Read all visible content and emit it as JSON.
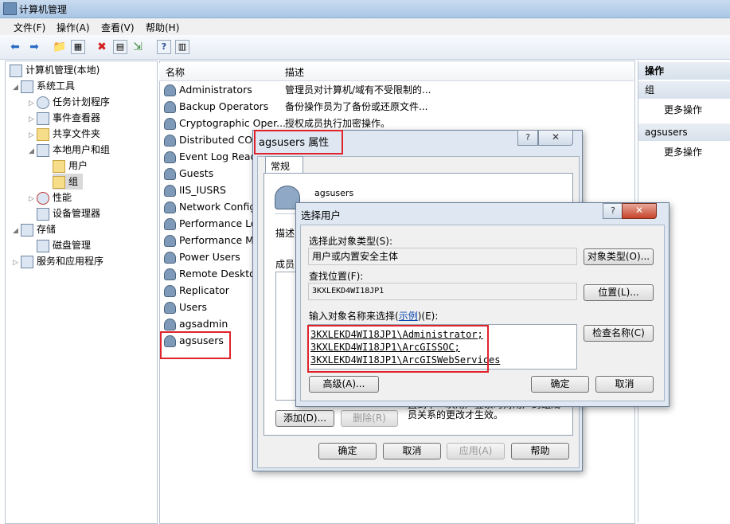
{
  "window": {
    "title": "计算机管理"
  },
  "menu": [
    "文件(F)",
    "操作(A)",
    "查看(V)",
    "帮助(H)"
  ],
  "tree": {
    "root": "计算机管理(本地)",
    "items": [
      "系统工具",
      "任务计划程序",
      "事件查看器",
      "共享文件夹",
      "本地用户和组",
      "用户",
      "组",
      "性能",
      "设备管理器",
      "存储",
      "磁盘管理",
      "服务和应用程序"
    ]
  },
  "list": {
    "col_name": "名称",
    "col_desc": "描述",
    "rows": [
      {
        "name": "Administrators",
        "desc": "管理员对计算机/域有不受限制的..."
      },
      {
        "name": "Backup Operators",
        "desc": "备份操作员为了备份或还原文件..."
      },
      {
        "name": "Cryptographic Oper...",
        "desc": "授权成员执行加密操作。"
      },
      {
        "name": "Distributed COM",
        "desc": ""
      },
      {
        "name": "Event Log Reade",
        "desc": ""
      },
      {
        "name": "Guests",
        "desc": ""
      },
      {
        "name": "IIS_IUSRS",
        "desc": ""
      },
      {
        "name": "Network Configu",
        "desc": ""
      },
      {
        "name": "Performance Lo",
        "desc": ""
      },
      {
        "name": "Performance Mo",
        "desc": ""
      },
      {
        "name": "Power Users",
        "desc": ""
      },
      {
        "name": "Remote Desktop",
        "desc": ""
      },
      {
        "name": "Replicator",
        "desc": ""
      },
      {
        "name": "Users",
        "desc": ""
      },
      {
        "name": "agsadmin",
        "desc": ""
      },
      {
        "name": "agsusers",
        "desc": ""
      }
    ]
  },
  "actions": {
    "header": "操作",
    "group1": "组",
    "more1": "更多操作",
    "group2": "agsusers",
    "more2": "更多操作"
  },
  "props_dialog": {
    "title": "agsusers 属性",
    "tab": "常规",
    "group_name": "agsusers",
    "desc_label": "描述",
    "members_label": "成员",
    "note": "直到下一次用户登录时对用户的组成员关系的更改才生效。",
    "btn_add": "添加(D)...",
    "btn_remove": "删除(R)",
    "btn_ok": "确定",
    "btn_cancel": "取消",
    "btn_apply": "应用(A)",
    "btn_help": "帮助"
  },
  "select_dialog": {
    "title": "选择用户",
    "obj_type_label": "选择此对象类型(S):",
    "obj_type_value": "用户或内置安全主体",
    "btn_obj_type": "对象类型(O)...",
    "location_label": "查找位置(F):",
    "location_value": "3KXLEKD4WI18JP1",
    "btn_location": "位置(L)...",
    "enter_label_a": "输入对象名称来选择(",
    "enter_link": "示例",
    "enter_label_b": ")(E):",
    "names": [
      "3KXLEKD4WI18JP1\\Administrator;",
      "3KXLEKD4WI18JP1\\ArcGISSOC;",
      "3KXLEKD4WI18JP1\\ArcGISWebServices"
    ],
    "btn_check": "检查名称(C)",
    "btn_advanced": "高级(A)...",
    "btn_ok": "确定",
    "btn_cancel": "取消"
  }
}
